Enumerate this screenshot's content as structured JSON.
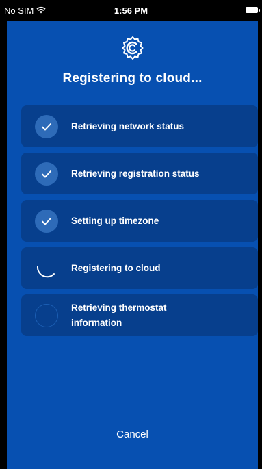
{
  "status_bar": {
    "carrier": "No SIM",
    "time": "1:56 PM"
  },
  "header": {
    "title": "Registering to cloud..."
  },
  "steps": [
    {
      "label": "Retrieving network status",
      "state": "done"
    },
    {
      "label": "Retrieving registration status",
      "state": "done"
    },
    {
      "label": "Setting up timezone",
      "state": "done"
    },
    {
      "label": "Registering to cloud",
      "state": "in-progress"
    },
    {
      "label": "Retrieving thermostat information",
      "state": "pending"
    }
  ],
  "footer": {
    "cancel_label": "Cancel"
  },
  "colors": {
    "background": "#0750b1",
    "card": "#073f8d",
    "check_circle": "#2e6bb8",
    "text": "#ffffff"
  },
  "icons": {
    "logo": "cloud-gear-logo-icon",
    "done": "checkmark-icon",
    "in_progress": "spinner-icon",
    "pending": "empty-circle-icon",
    "wifi": "wifi-icon",
    "battery": "battery-icon"
  }
}
